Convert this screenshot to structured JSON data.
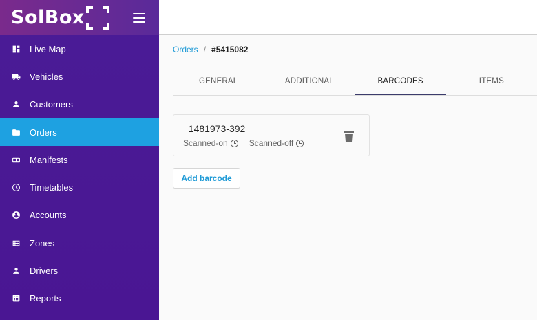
{
  "brand": {
    "logo_text": "SolBox"
  },
  "sidebar": {
    "items": [
      {
        "label": "Live Map",
        "icon": "dashboard-icon"
      },
      {
        "label": "Vehicles",
        "icon": "truck-icon"
      },
      {
        "label": "Customers",
        "icon": "person-icon"
      },
      {
        "label": "Orders",
        "icon": "folder-icon",
        "active": true
      },
      {
        "label": "Manifests",
        "icon": "card-icon"
      },
      {
        "label": "Timetables",
        "icon": "clock-icon"
      },
      {
        "label": "Accounts",
        "icon": "account-circle-icon"
      },
      {
        "label": "Zones",
        "icon": "grid-icon"
      },
      {
        "label": "Drivers",
        "icon": "person-icon"
      },
      {
        "label": "Reports",
        "icon": "list-icon"
      }
    ]
  },
  "breadcrumb": {
    "parent": "Orders",
    "separator": "/",
    "current": "#5415082"
  },
  "tabs": [
    {
      "label": "GENERAL"
    },
    {
      "label": "ADDITIONAL"
    },
    {
      "label": "BARCODES",
      "active": true
    },
    {
      "label": "ITEMS"
    }
  ],
  "barcode": {
    "code": "_1481973-392",
    "scanned_on": "Scanned-on",
    "scanned_off": "Scanned-off"
  },
  "actions": {
    "add_barcode": "Add barcode"
  },
  "colors": {
    "sidebar": "#4a1693",
    "active": "#1ea1e1",
    "link": "#1e9ad6"
  }
}
